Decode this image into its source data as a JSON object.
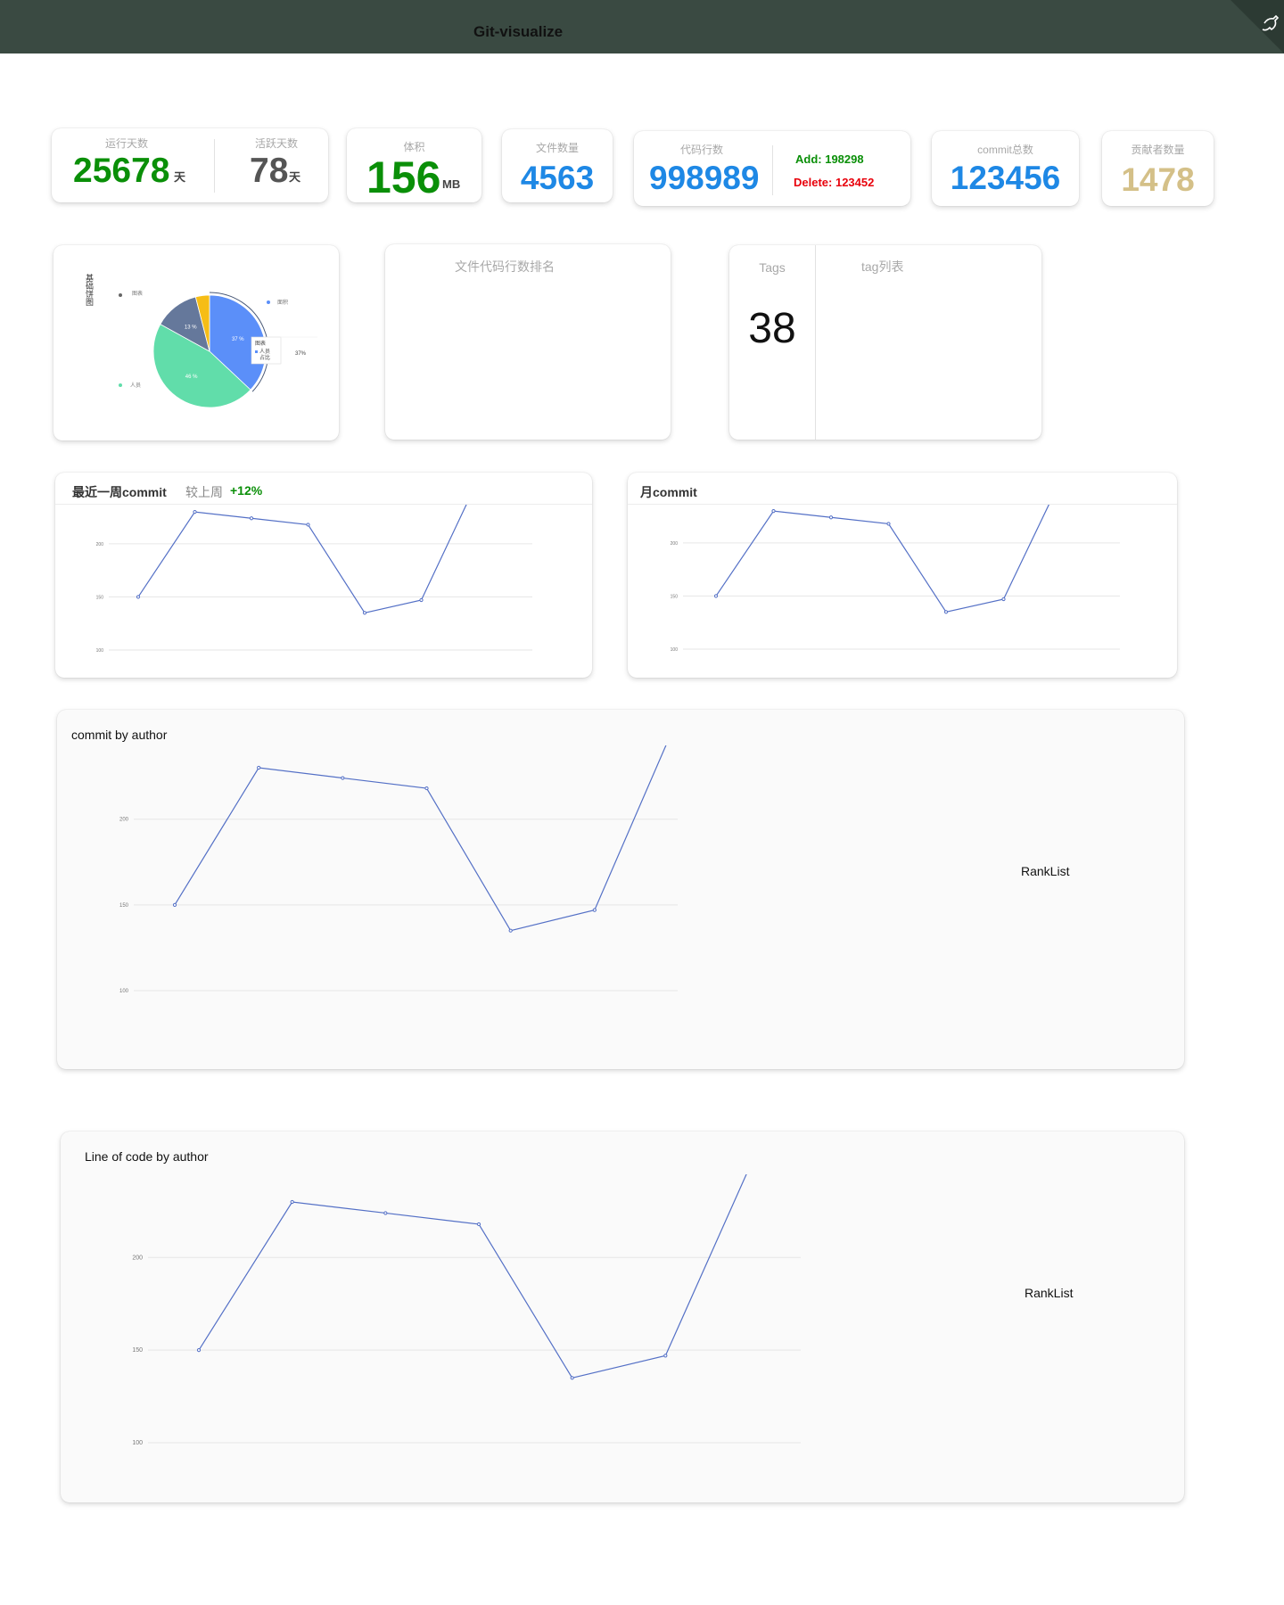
{
  "header": {
    "title": "Git-visualize"
  },
  "stats": {
    "run_days": {
      "label": "运行天数",
      "value": "25678",
      "unit": "天"
    },
    "active_days": {
      "label": "活跃天数",
      "value": "78",
      "unit": "天"
    },
    "size": {
      "label": "体积",
      "value": "156",
      "unit": "MB"
    },
    "files": {
      "label": "文件数量",
      "value": "4563"
    },
    "lines": {
      "label": "代码行数",
      "value": "998989",
      "add": "Add: 198298",
      "delete": "Delete: 123452"
    },
    "commits": {
      "label": "commit总数",
      "value": "123456"
    },
    "contributors": {
      "label": "贡献者数量",
      "value": "1478"
    }
  },
  "pie_card": {
    "title": "基础饼图",
    "legend": [
      "图表",
      "面积",
      "人员",
      "人员"
    ],
    "slice_labels": [
      "37 %",
      "46 %",
      "13 %"
    ],
    "tooltip": {
      "name": "人员",
      "line2": "占比",
      "value": "37%",
      "caption": "图表"
    }
  },
  "file_rank": {
    "title": "文件代码行数排名"
  },
  "tags": {
    "label": "Tags",
    "count": "38",
    "list_title": "tag列表"
  },
  "weekly": {
    "title": "最近一周commit",
    "compare_label": "较上周",
    "compare_value": "+12%"
  },
  "monthly": {
    "title": "月commit"
  },
  "commit_by_author": {
    "title": "commit by author",
    "rank_label": "RankList"
  },
  "loc_by_author": {
    "title": "Line of code by author",
    "rank_label": "RankList"
  },
  "colors": {
    "green": "#0a8f08",
    "blue": "#1e88e5",
    "gold": "#d4c088",
    "red": "#e8000b",
    "line": "#5470c6"
  },
  "chart_data": [
    {
      "type": "pie",
      "title": "基础饼图",
      "slices": [
        {
          "value": 37,
          "color": "#5b8ff9"
        },
        {
          "value": 46,
          "color": "#61ddaa"
        },
        {
          "value": 13,
          "color": "#65789b"
        },
        {
          "value": 4,
          "color": "#f6bd16"
        }
      ]
    },
    {
      "type": "line",
      "title": "最近一周commit",
      "y": [
        150,
        230,
        224,
        218,
        135,
        147,
        260
      ],
      "yticks": [
        "200",
        "150",
        "100"
      ],
      "ylim": [
        100,
        215
      ]
    },
    {
      "type": "line",
      "title": "月commit",
      "y": [
        150,
        230,
        224,
        218,
        135,
        147,
        260
      ],
      "yticks": [
        "200",
        "150",
        "100"
      ],
      "ylim": [
        100,
        215
      ]
    },
    {
      "type": "line",
      "title": "commit by author",
      "y": [
        150,
        230,
        224,
        218,
        135,
        147,
        260
      ],
      "yticks": [
        "200",
        "150",
        "100"
      ],
      "ylim": [
        100,
        230
      ]
    },
    {
      "type": "line",
      "title": "Line of code by author",
      "y": [
        150,
        230,
        224,
        218,
        135,
        147,
        260
      ],
      "yticks": [
        "200",
        "150",
        "100"
      ],
      "ylim": [
        100,
        230
      ]
    }
  ]
}
